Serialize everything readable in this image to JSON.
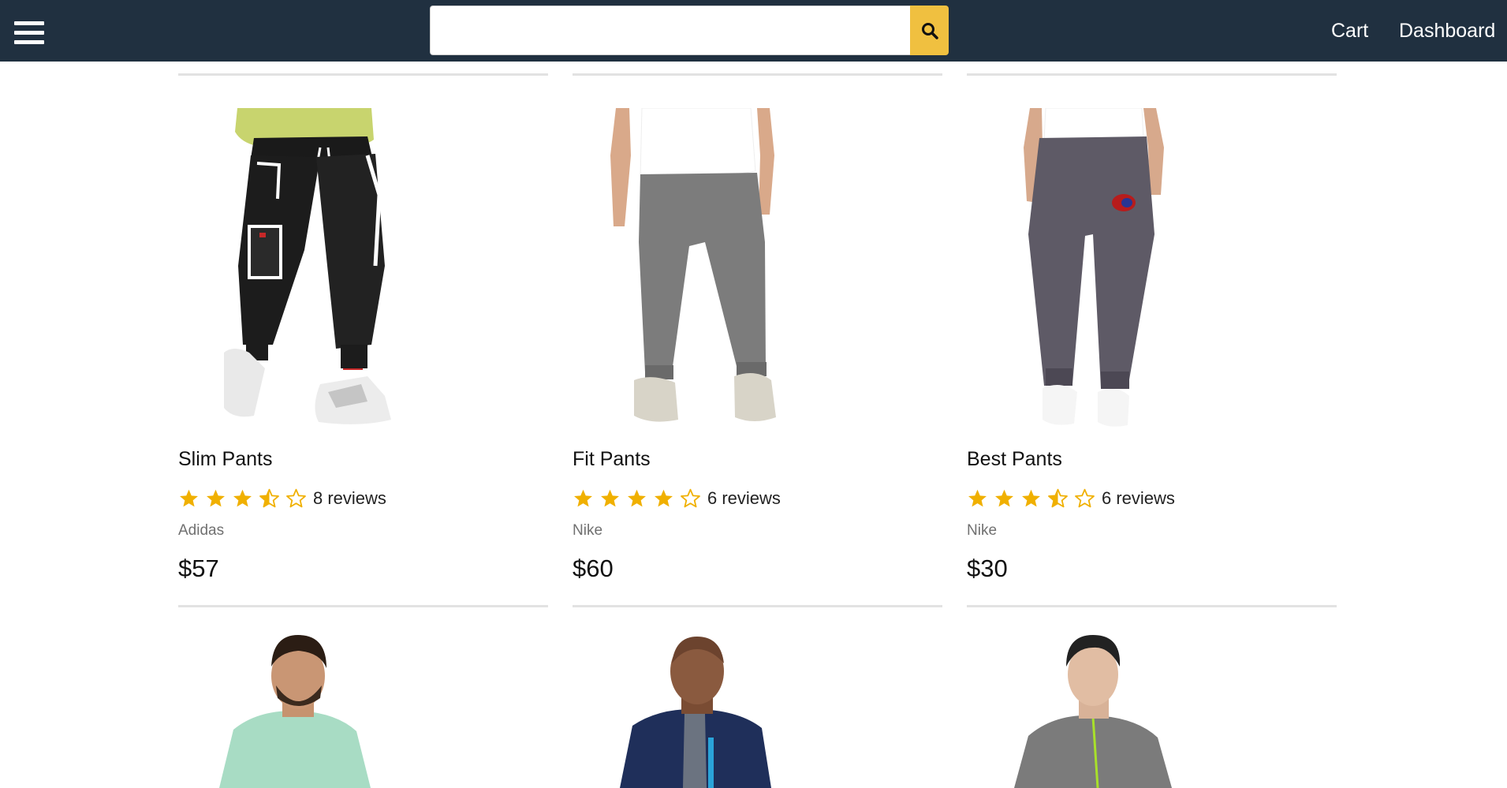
{
  "header": {
    "search_placeholder": "",
    "search_value": "",
    "cart_label": "Cart",
    "dashboard_label": "Dashboard",
    "menu_icon": "hamburger-menu-icon",
    "search_icon": "search-icon",
    "colors": {
      "header_bg": "#203040",
      "search_button": "#f0c040",
      "star": "#f0b000"
    }
  },
  "products": [
    {
      "name": "Slim Pants",
      "rating": 3.5,
      "reviews": "8 reviews",
      "brand": "Adidas",
      "price": "$57"
    },
    {
      "name": "Fit Pants",
      "rating": 4,
      "reviews": "6 reviews",
      "brand": "Nike",
      "price": "$60"
    },
    {
      "name": "Best Pants",
      "rating": 3.5,
      "reviews": "6 reviews",
      "brand": "Nike",
      "price": "$30"
    }
  ],
  "next_row_images": [
    "mint-hoodie-model-image",
    "navy-jacket-model-image",
    "gray-zip-top-model-image"
  ]
}
